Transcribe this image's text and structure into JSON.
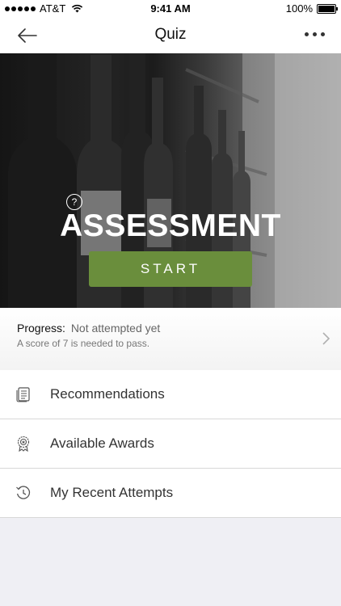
{
  "status_bar": {
    "carrier": "AT&T",
    "time": "9:41 AM",
    "battery": "100%"
  },
  "nav": {
    "title": "Quiz",
    "back_icon": "arrow-left-icon",
    "more_icon": "more-horizontal-icon"
  },
  "hero": {
    "title": "ASSESSMENT",
    "help_icon": "question-circle-icon",
    "help_glyph": "?",
    "start_label": "START",
    "start_color": "#6a8e3c"
  },
  "progress": {
    "label": "Progress:",
    "status": "Not attempted yet",
    "note": "A score of 7 is needed to pass."
  },
  "menu": {
    "items": [
      {
        "label": "Recommendations",
        "icon": "document-list-icon"
      },
      {
        "label": "Available Awards",
        "icon": "award-badge-icon"
      },
      {
        "label": "My Recent Attempts",
        "icon": "history-clock-icon"
      }
    ]
  }
}
